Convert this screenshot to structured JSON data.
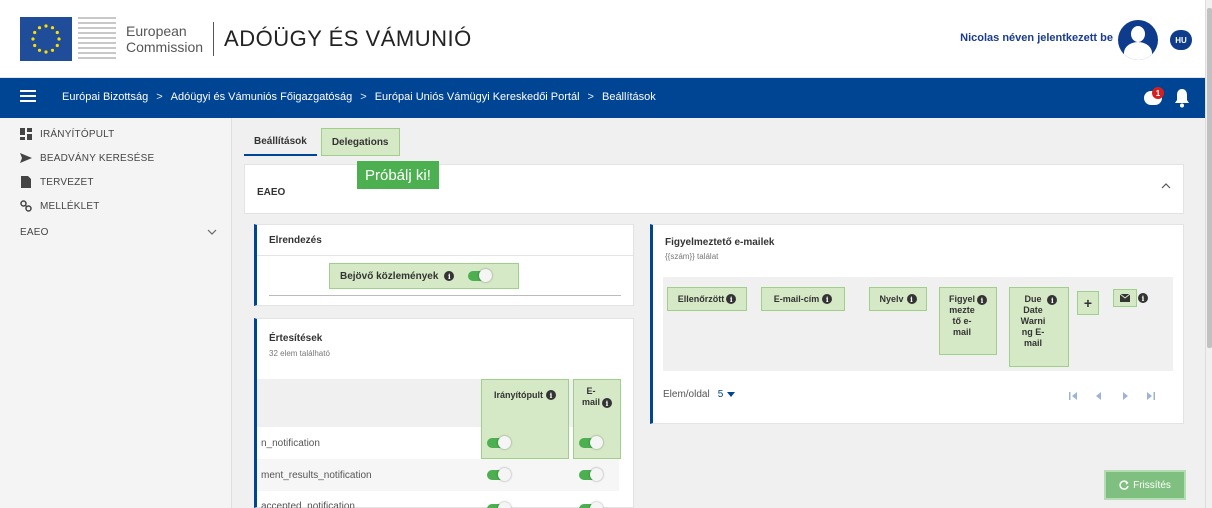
{
  "header": {
    "brand_line1": "European",
    "brand_line2": "Commission",
    "app_title": "ADÓÜGY ÉS VÁMUNIÓ",
    "user_text": "Nicolas néven jelentkezett be",
    "language": "HU"
  },
  "navbar": {
    "breadcrumb": [
      "Európai Bizottság",
      "Adóügyi és Vámuniós Főigazgatóság",
      "Európai Uniós Vámügyi Kereskedői Portál",
      "Beállítások"
    ],
    "separator": ">",
    "notification_count": "1"
  },
  "sidebar": {
    "items": [
      {
        "label": "IRÁNYÍTÓPULT",
        "icon": "dashboard-icon"
      },
      {
        "label": "BEADVÁNY KERESÉSE",
        "icon": "send-icon"
      },
      {
        "label": "TERVEZET",
        "icon": "document-icon"
      },
      {
        "label": "MELLÉKLET",
        "icon": "attachment-icon"
      },
      {
        "label": "EAEO",
        "icon": "chevron-down-icon"
      }
    ]
  },
  "tabs": {
    "settings": "Beállítások",
    "delegations": "Delegations"
  },
  "eaeo_section": {
    "title": "EAEO",
    "try_badge": "Próbálj ki!"
  },
  "layout_panel": {
    "title": "Elrendezés",
    "toggle_label": "Bejövő közlemények"
  },
  "notifications_panel": {
    "title": "Értesítések",
    "subtitle": "32 elem található",
    "col_dashboard": "Irányítópult",
    "col_email_1": "E-",
    "col_email_2": "mail",
    "rows": [
      "n_notification",
      "ment_results_notification",
      "accepted_notification"
    ]
  },
  "warning_panel": {
    "title": "Figyelmeztető e-mailek",
    "subtitle": "{{szám}} találat",
    "columns": {
      "checked": "Ellenőrzött",
      "email": "E-mail-cím",
      "language": "Nyelv",
      "warning_1": "Figyel",
      "warning_2": "mezte",
      "warning_3": "tő e-",
      "warning_4": "mail",
      "due_1": "Due",
      "due_2": "Date",
      "due_3": "Warni",
      "due_4": "ng E-",
      "due_5": "mail",
      "add": "+"
    },
    "per_page_label": "Elem/oldal",
    "per_page_value": "5"
  },
  "refresh_button": "Frissítés",
  "colors": {
    "nav_blue": "#004494",
    "highlight_green": "#d6e9c6",
    "toggle_green": "#4caf50"
  }
}
